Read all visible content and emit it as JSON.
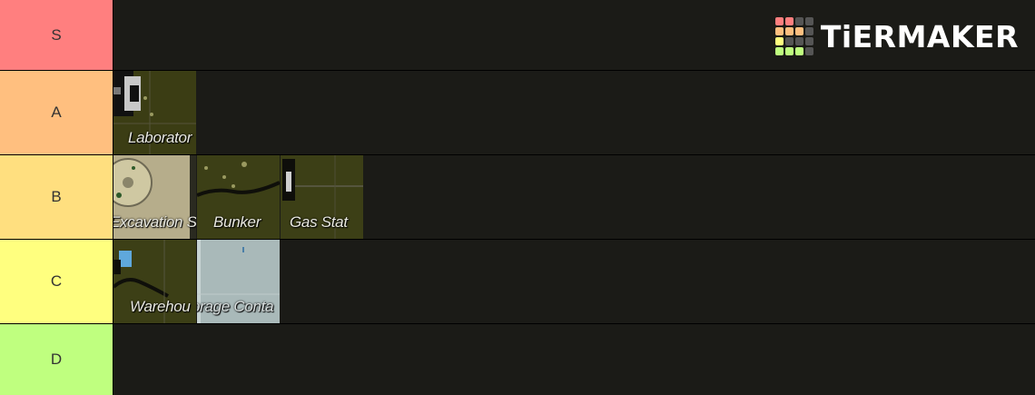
{
  "brand": {
    "logo_text": "TiERMAKER"
  },
  "tiers": [
    {
      "label": "S",
      "color": "#ff7f7f",
      "items": []
    },
    {
      "label": "A",
      "color": "#ffbf7f",
      "items": [
        "Laboratory"
      ]
    },
    {
      "label": "B",
      "color": "#ffdf7f",
      "items": [
        "Excavation Site",
        "Bunker",
        "Gas Station"
      ]
    },
    {
      "label": "C",
      "color": "#ffff7f",
      "items": [
        "Warehouse",
        "Storage Containers"
      ]
    },
    {
      "label": "D",
      "color": "#bfff7f",
      "items": []
    }
  ],
  "tile_captions": {
    "a0": "Laborator",
    "b0": "Excavation S",
    "b1": "Bunker",
    "b2": "Gas Stat",
    "c0": "Warehou",
    "c1": "orage Conta"
  }
}
